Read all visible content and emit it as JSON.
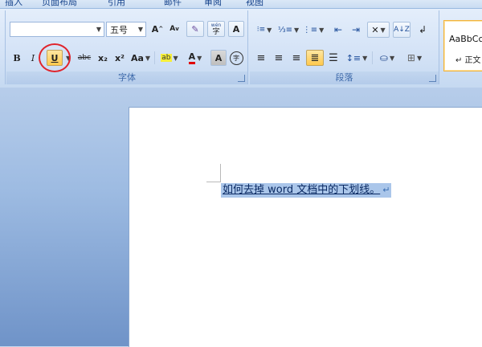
{
  "tabs": [
    "插入",
    "页面布局",
    "引用",
    "邮件",
    "审阅",
    "视图"
  ],
  "font_group": {
    "label": "字体",
    "font_name": "",
    "font_size": "五号",
    "grow_label": "A",
    "shrink_label": "A",
    "bold_label": "B",
    "italic_label": "I",
    "underline_label": "U",
    "strike_label": "abc",
    "subscript_label": "x₂",
    "superscript_label": "x²",
    "case_label": "Aa",
    "highlight_label": "ab",
    "font_color_label": "A",
    "shade_label": "A",
    "enclose_label": "字",
    "phonetic_label": "wén",
    "border_label": "A"
  },
  "paragraph_group": {
    "label": "段落"
  },
  "styles_group": {
    "preview": "AaBbCc",
    "style_name": "↵ 正文"
  },
  "document": {
    "text": "如何去掉 word 文档中的下划线。",
    "paragraph_mark": "↵"
  },
  "colors": {
    "active_button": "#ffc94d",
    "annotation_circle": "#e0242c",
    "selection": "#aac6ea"
  }
}
